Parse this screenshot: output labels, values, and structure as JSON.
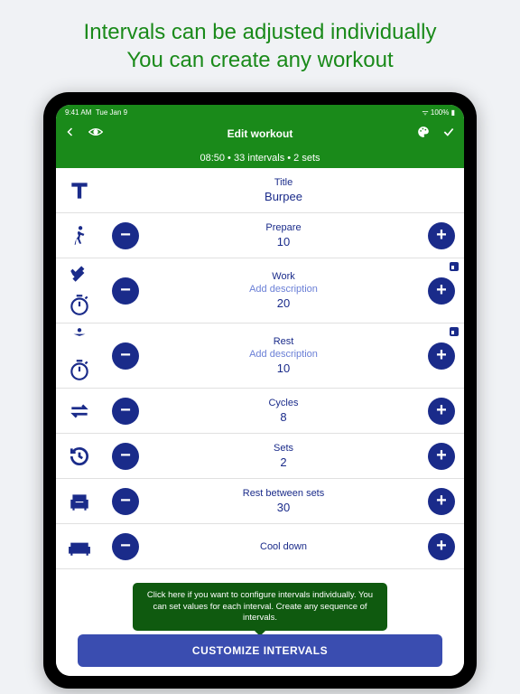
{
  "promo": {
    "line1": "Intervals can be adjusted individually",
    "line2": "You can create any workout"
  },
  "status": {
    "time": "9:41 AM",
    "date": "Tue Jan 9",
    "battery": "100%"
  },
  "header": {
    "title": "Edit workout"
  },
  "subheader": {
    "text": "08:50 • 33 intervals • 2 sets"
  },
  "rows": {
    "title": {
      "label": "Title",
      "value": "Burpee"
    },
    "prepare": {
      "label": "Prepare",
      "value": "10"
    },
    "work": {
      "label": "Work",
      "desc": "Add description",
      "value": "20"
    },
    "rest": {
      "label": "Rest",
      "desc": "Add description",
      "value": "10"
    },
    "cycles": {
      "label": "Cycles",
      "value": "8"
    },
    "sets": {
      "label": "Sets",
      "value": "2"
    },
    "restBetween": {
      "label": "Rest between sets",
      "value": "30"
    },
    "cooldown": {
      "label": "Cool down"
    }
  },
  "tooltip": "Click here if you want to configure intervals individually. You can set values for each interval. Create any sequence of intervals.",
  "customize": "CUSTOMIZE INTERVALS",
  "colors": {
    "accent": "#1a2b8a",
    "green": "#1a8a1a"
  }
}
